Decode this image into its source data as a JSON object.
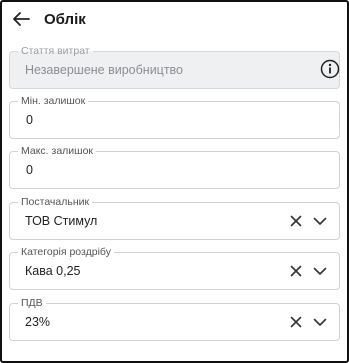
{
  "header": {
    "title": "Облік",
    "back_icon": "arrow-left-icon"
  },
  "fields": {
    "expense_item": {
      "label": "Стаття витрат",
      "value": "Незавершене виробництво"
    },
    "min_stock": {
      "label": "Мін. залишок",
      "value": "0"
    },
    "max_stock": {
      "label": "Макс. залишок",
      "value": "0"
    },
    "supplier": {
      "label": "Постачальник",
      "value": "ТОВ Стимул"
    },
    "retail_category": {
      "label": "Категорія роздрібу",
      "value": "Кава 0,25"
    },
    "vat": {
      "label": "ПДВ",
      "value": "23%"
    }
  },
  "icons": {
    "clear": "close-icon",
    "dropdown": "chevron-down-icon",
    "info": "info-icon"
  }
}
